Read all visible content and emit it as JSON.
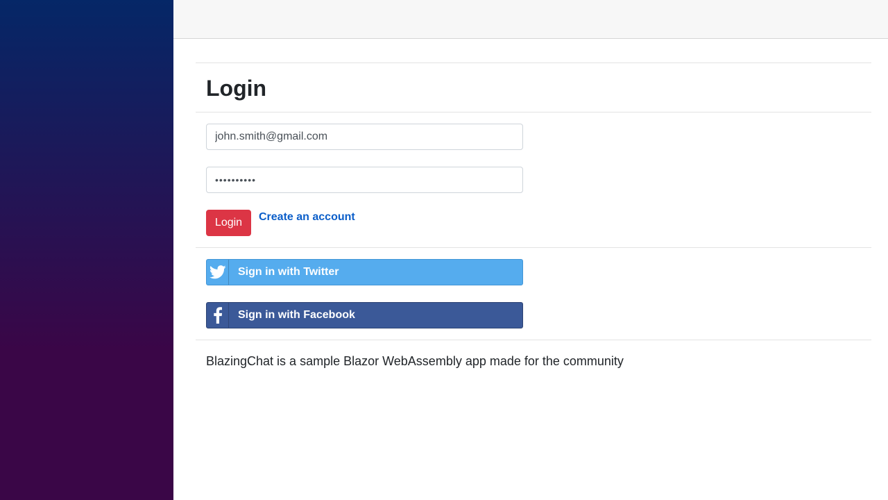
{
  "page": {
    "title": "Login"
  },
  "form": {
    "email_value": "john.smith@gmail.com",
    "password_value": "••••••••••",
    "login_label": "Login",
    "create_account_label": "Create an account"
  },
  "social": {
    "twitter_label": "Sign in with Twitter",
    "twitter_icon": "twitter-icon",
    "facebook_label": "Sign in with Facebook",
    "facebook_icon": "facebook-icon"
  },
  "footer": {
    "text": "BlazingChat is a sample Blazor WebAssembly app made for the community"
  },
  "colors": {
    "sidebar_top": "#052767",
    "sidebar_bottom": "#3a0647",
    "login_button": "#dc3545",
    "link": "#0b5ec9",
    "twitter": "#55acee",
    "facebook": "#3b5998"
  }
}
